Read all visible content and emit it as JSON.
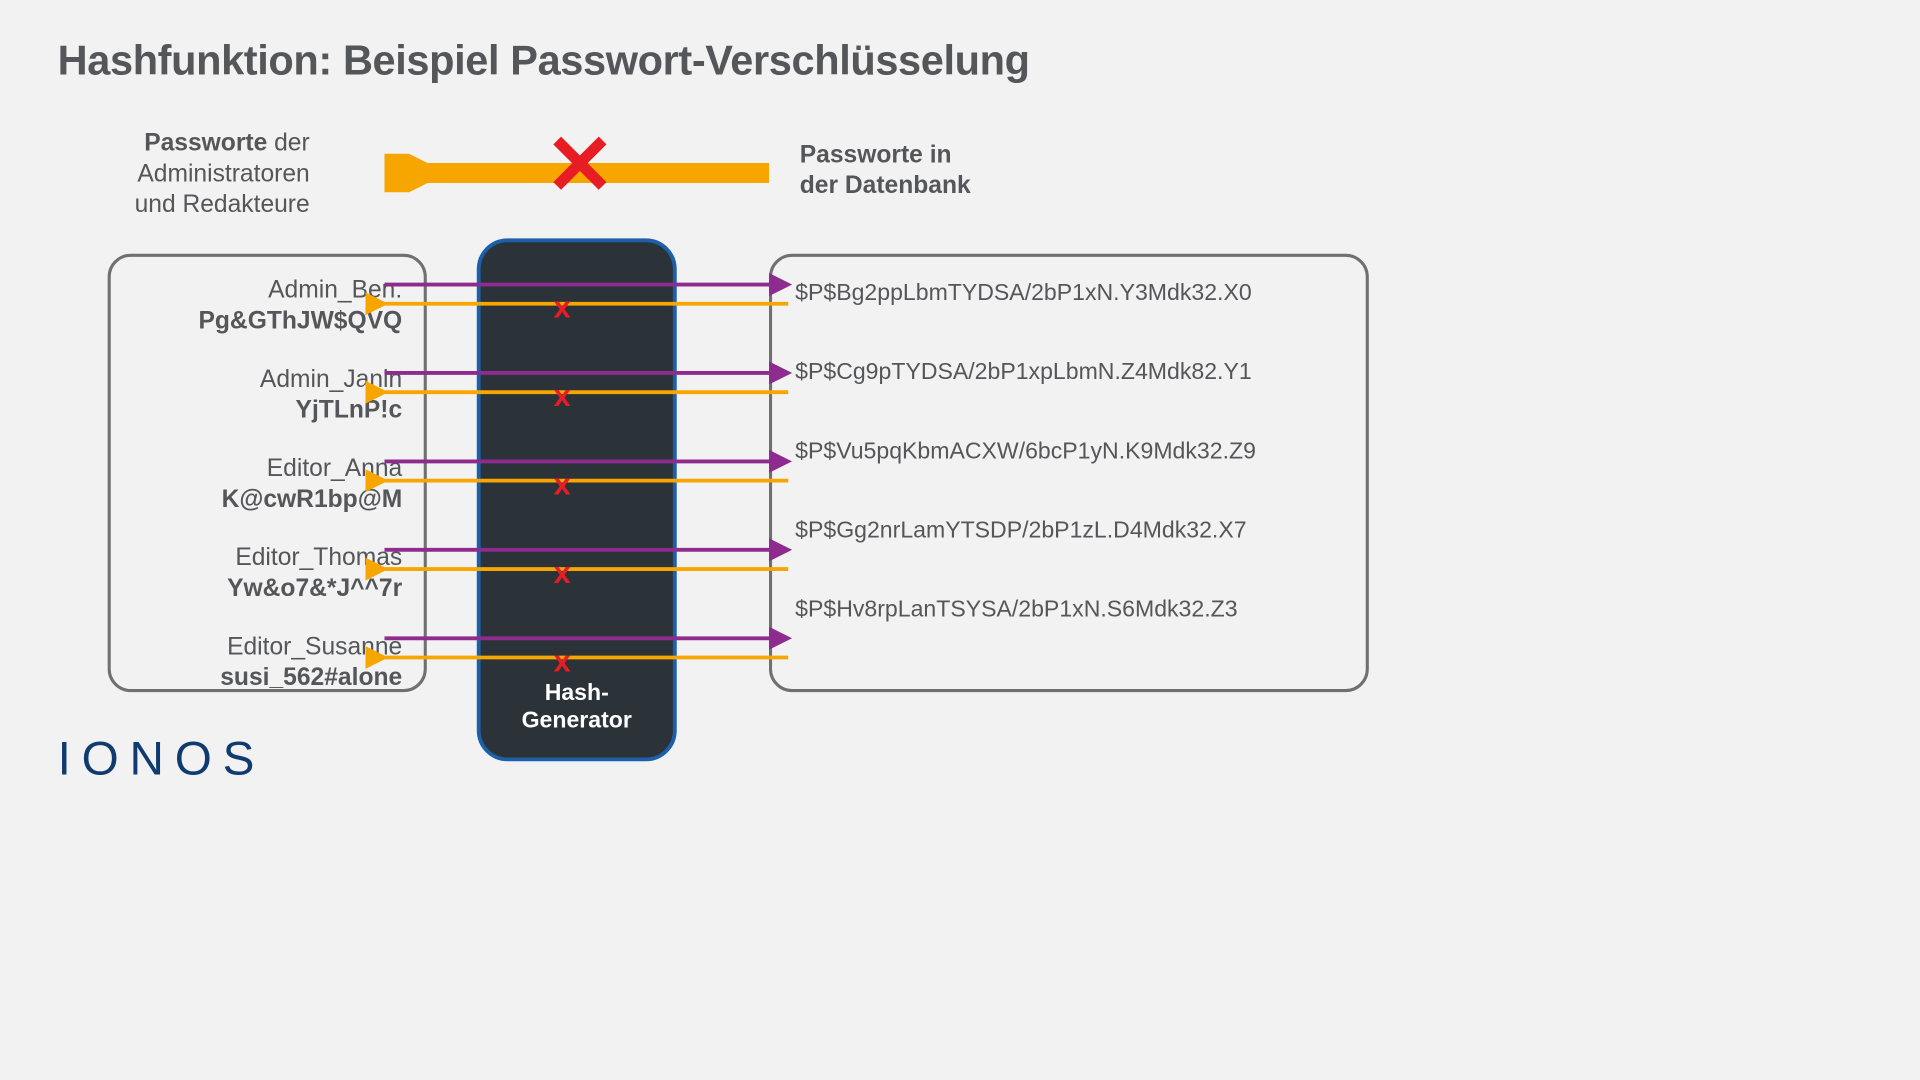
{
  "title": "Hashfunktion: Beispiel Passwort-Verschlüsselung",
  "labels": {
    "left_bold": "Passworte",
    "left_rest1": " der",
    "left_line2": "Administratoren",
    "left_line3": "und Redakteure",
    "right_line1": "Passworte in",
    "right_line2": "der Datenbank",
    "center_line1": "Hash-",
    "center_line2": "Generator"
  },
  "users": [
    {
      "name": "Admin_Ben:",
      "pw": "Pg&GThJW$QVQ",
      "hash": "$P$Bg2ppLbmTYDSA/2bP1xN.Y3Mdk32.X0"
    },
    {
      "name": "Admin_Janin",
      "pw": "YjTLnP!c",
      "hash": "$P$Cg9pTYDSA/2bP1xpLbmN.Z4Mdk82.Y1"
    },
    {
      "name": "Editor_Anna",
      "pw": "K@cwR1bp@M",
      "hash": "$P$Vu5pqKbmACXW/6bcP1yN.K9Mdk32.Z9"
    },
    {
      "name": "Editor_Thomas",
      "pw": "Yw&o7&*J^^7r",
      "hash": "$P$Gg2nrLamYTSDP/2bP1zL.D4Mdk32.X7"
    },
    {
      "name": "Editor_Susanne",
      "pw": "susi_562#alone",
      "hash": "$P$Hv8rpLanTSYSA/2bP1xN.S6Mdk32.Z3"
    }
  ],
  "colors": {
    "arrow_big": "#f7a600",
    "arrow_forward": "#8e2b8e",
    "arrow_back": "#f7a600",
    "cross": "#e81c23"
  },
  "brand": "IONOS"
}
